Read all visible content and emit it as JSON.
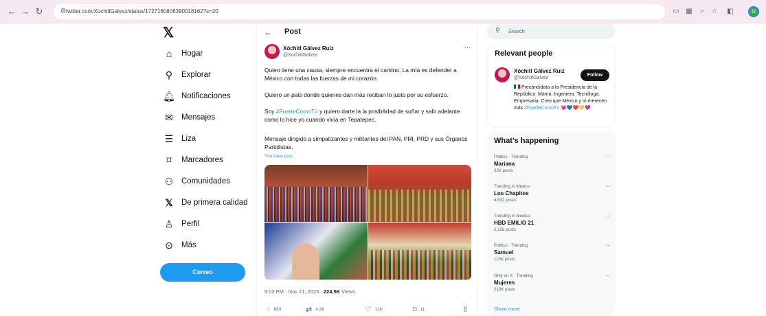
{
  "browser": {
    "url": "twitter.com/XochitlGalvez/status/1727160806390018162?s=20",
    "profile_initial": "U"
  },
  "sidebar": {
    "items": [
      {
        "label": "Hogar",
        "icon": "home-icon"
      },
      {
        "label": "Explorar",
        "icon": "search-icon"
      },
      {
        "label": "Notificaciones",
        "icon": "bell-icon"
      },
      {
        "label": "Mensajes",
        "icon": "mail-icon"
      },
      {
        "label": "Liza",
        "icon": "list-icon"
      },
      {
        "label": "Marcadores",
        "icon": "bookmark-icon"
      },
      {
        "label": "Comunidades",
        "icon": "communities-icon"
      },
      {
        "label": "De primera calidad",
        "icon": "x-logo-icon"
      },
      {
        "label": "Perfil",
        "icon": "person-icon"
      },
      {
        "label": "Más",
        "icon": "more-circle-icon"
      }
    ],
    "post_button": "Correo"
  },
  "post": {
    "header": "Post",
    "author_name": "Xóchitl Gálvez Ruiz",
    "author_handle": "@XochitlGalvez",
    "para1": "Quien tiene una causa, siempre encuentra el camino. La mía es defender a México con todas las fuerzas de mi corazón.",
    "para2": "Quiero un país donde quienes dan más reciban lo justo por su esfuerzo.",
    "para3_hashtag": "#FuerteComoTú",
    "para3_pre": "Soy ",
    "para3_post": " y quiero darte la la posibilidad de soñar y salir adelante como lo hice yo cuando vivía en Tepatepec.",
    "para4": "Mensaje dirigido a simpatizantes y militantes del PAN, PRI, PRD y sus Órganos Partidistas.",
    "translate": "Translate post",
    "timestamp": "9:03 PM · Nov 21, 2023 · ",
    "views_count": "224.5K",
    "views_label": " Views",
    "replies": "683",
    "reposts": "4.2K",
    "likes": "11K",
    "bookmarks": "11"
  },
  "right": {
    "search_placeholder": "Search",
    "relevant_title": "Relevant people",
    "person_name": "Xóchitl Gálvez Ruiz",
    "person_handle": "@XochitlGalvez",
    "follow": "Follow",
    "bio": "Precandidata a la Presidencia de la República. Mamá. Ingeniera. Tecnóloga. Empresaria. Creo que México y tú merecen más",
    "bio_hashtag": "#FuerteComoTú",
    "bio_hearts": "💗💙❤️💛💜",
    "happening_title": "What’s happening",
    "trends": [
      {
        "category": "Politics · Trending",
        "name": "Mariana",
        "count": "32K posts"
      },
      {
        "category": "Trending in Mexico",
        "name": "Los Chapitos",
        "count": "4,532 posts"
      },
      {
        "category": "Trending in Mexico",
        "name": "HBD EMILIO 21",
        "count": "2,156 posts"
      },
      {
        "category": "Politics · Trending",
        "name": "Samuel",
        "count": "119K posts"
      },
      {
        "category": "Only on X · Trending",
        "name": "Mujeres",
        "count": "210K posts"
      }
    ],
    "show_more": "Show more"
  }
}
